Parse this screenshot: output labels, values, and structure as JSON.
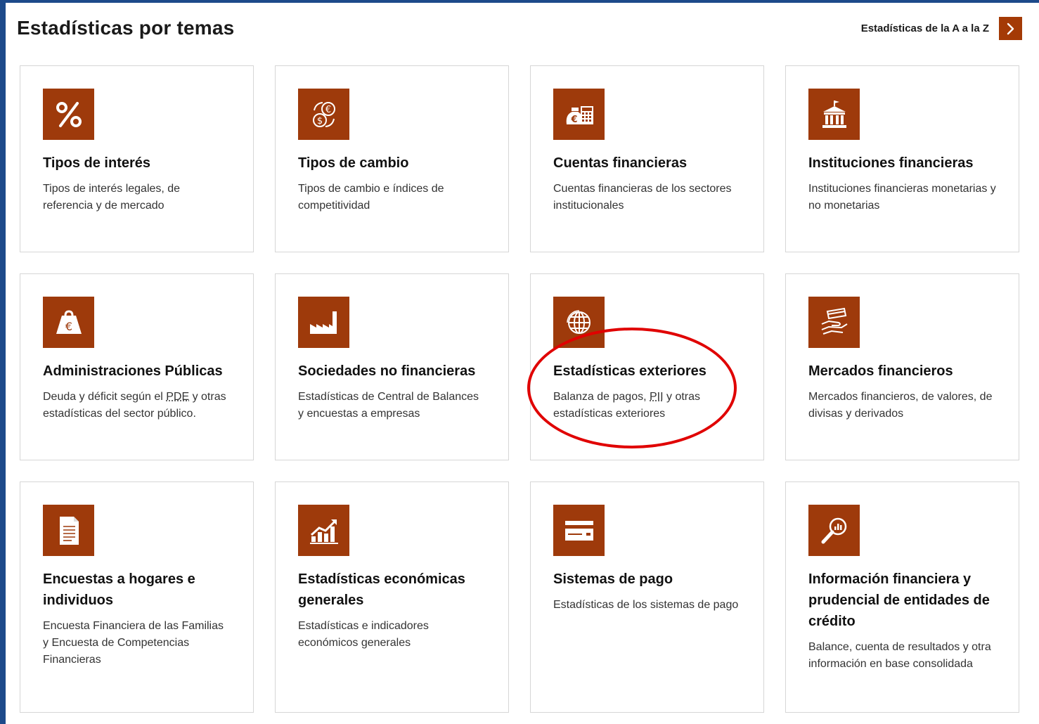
{
  "header": {
    "title": "Estadísticas por temas",
    "az_link": "Estadísticas de la A a la Z"
  },
  "cards": [
    {
      "title": "Tipos de interés",
      "desc": "Tipos de interés legales, de referencia y de mercado",
      "icon": "percent-icon"
    },
    {
      "title": "Tipos de cambio",
      "desc": "Tipos de cambio e índices de competitividad",
      "icon": "currency-exchange-icon"
    },
    {
      "title": "Cuentas financieras",
      "desc": "Cuentas financieras de los sectores institucionales",
      "icon": "money-calculator-icon"
    },
    {
      "title": "Instituciones financieras",
      "desc": "Instituciones financieras monetarias y no monetarias",
      "icon": "bank-building-icon"
    },
    {
      "title": "Administraciones Públicas",
      "desc_parts": [
        "Deuda y déficit según el ",
        "PDE",
        " y otras estadísticas del sector público."
      ],
      "icon": "euro-weight-icon"
    },
    {
      "title": "Sociedades no financieras",
      "desc": "Estadísticas de Central de Balances y encuestas a empresas",
      "icon": "factory-icon"
    },
    {
      "title": "Estadísticas exteriores",
      "desc_parts": [
        "Balanza de pagos, ",
        "PII",
        " y otras estadísticas exteriores"
      ],
      "icon": "globe-icon"
    },
    {
      "title": "Mercados financieros",
      "desc": "Mercados financieros, de valores, de divisas y derivados",
      "icon": "hand-card-icon"
    },
    {
      "title": "Encuestas a hogares e individuos",
      "desc": "Encuesta Financiera de las Familias y Encuesta de Competencias Financieras",
      "icon": "document-icon"
    },
    {
      "title": "Estadísticas económicas generales",
      "desc": "Estadísticas e indicadores económicos generales",
      "icon": "chart-growth-icon"
    },
    {
      "title": "Sistemas de pago",
      "desc": "Estadísticas de los sistemas de pago",
      "icon": "payment-card-icon"
    },
    {
      "title": "Información financiera y prudencial de entidades de crédito",
      "desc": "Balance, cuenta de resultados y otra información en base consolidada",
      "icon": "magnifier-chart-icon"
    }
  ],
  "colors": {
    "accent": "#9e3a0b",
    "frame": "#1d4a8a",
    "highlight": "#e00000"
  }
}
